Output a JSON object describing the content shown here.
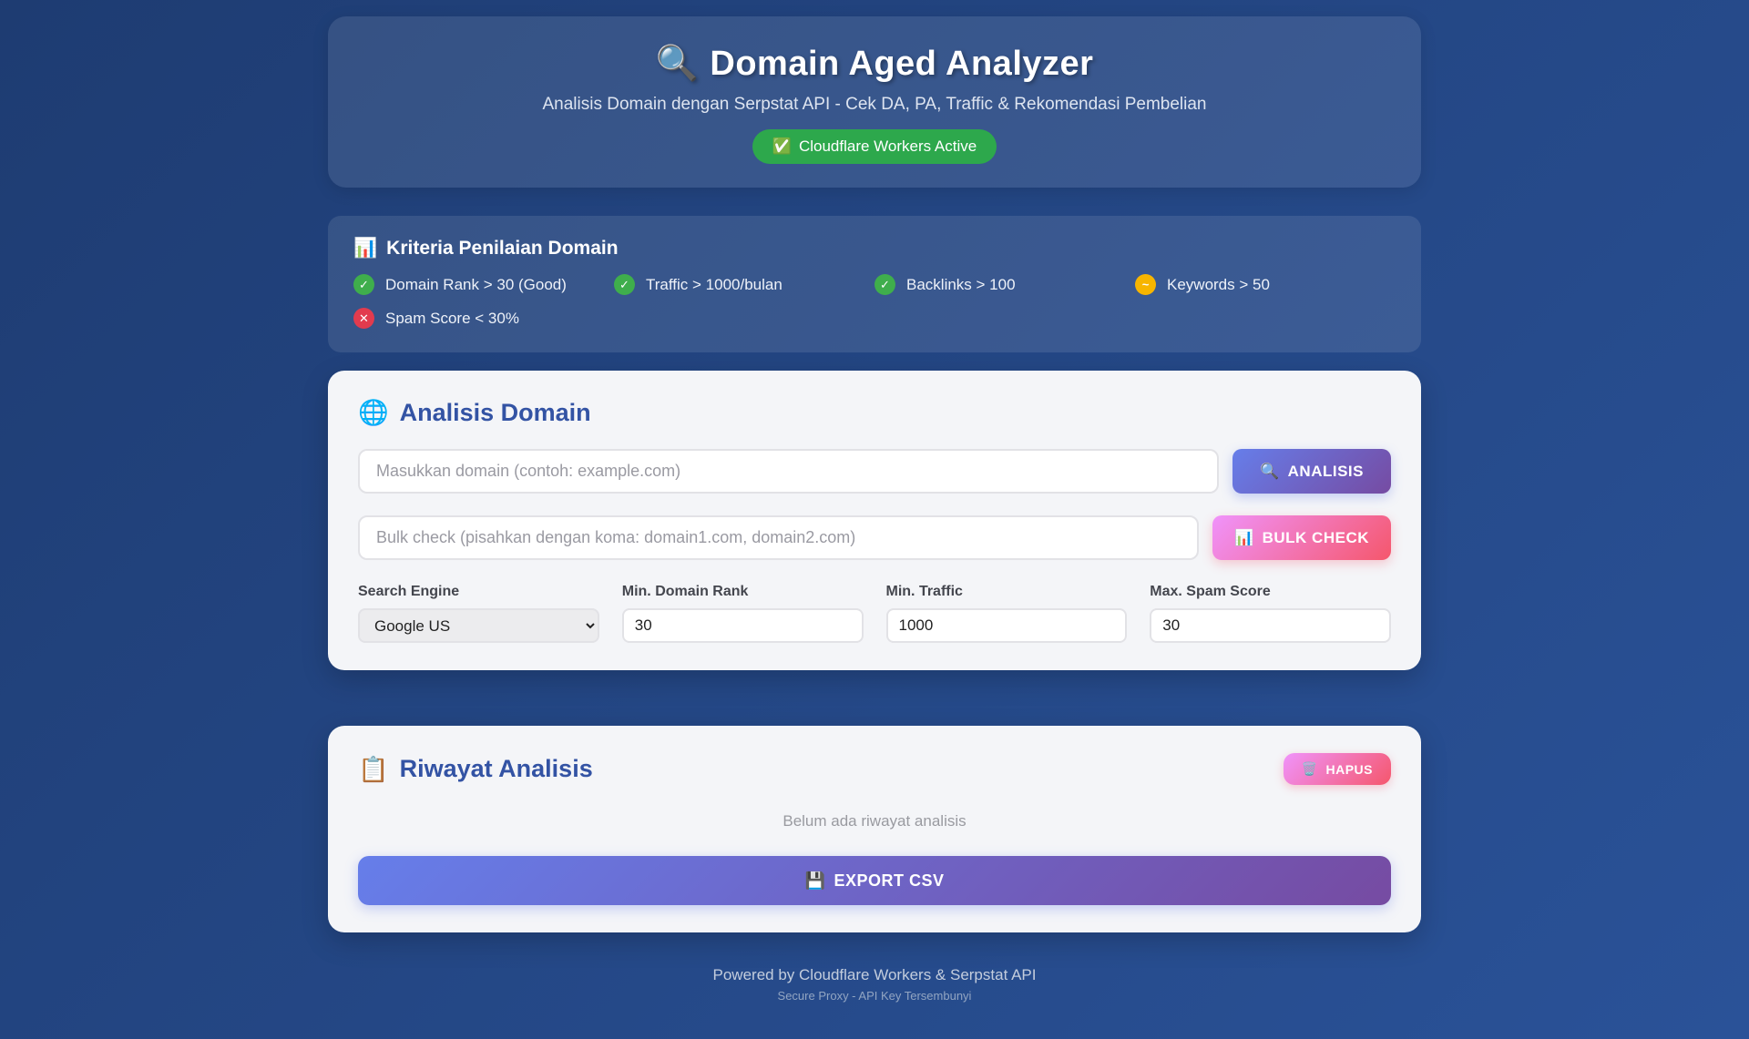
{
  "header": {
    "icon": "🔍",
    "title": "Domain Aged Analyzer",
    "subtitle": "Analisis Domain dengan Serpstat API - Cek DA, PA, Traffic & Rekomendasi Pembelian",
    "status_badge": {
      "icon": "✅",
      "label": "Cloudflare Workers Active"
    }
  },
  "criteria": {
    "icon": "📊",
    "title": "Kriteria Penilaian Domain",
    "items": [
      {
        "status": "pass",
        "glyph": "✓",
        "label": "Domain Rank > 30 (Good)"
      },
      {
        "status": "pass",
        "glyph": "✓",
        "label": "Traffic > 1000/bulan"
      },
      {
        "status": "pass",
        "glyph": "✓",
        "label": "Backlinks > 100"
      },
      {
        "status": "warn",
        "glyph": "~",
        "label": "Keywords > 50"
      },
      {
        "status": "fail",
        "glyph": "✕",
        "label": "Spam Score < 30%"
      }
    ]
  },
  "analyzer": {
    "icon": "🌐",
    "title": "Analisis Domain",
    "domain_input_placeholder": "Masukkan domain (contoh: example.com)",
    "analyze_button": {
      "icon": "🔍",
      "label": "ANALISIS"
    },
    "bulk_input_placeholder": "Bulk check (pisahkan dengan koma: domain1.com, domain2.com)",
    "bulk_button": {
      "icon": "📊",
      "label": "BULK CHECK"
    },
    "fields": {
      "search_engine": {
        "label": "Search Engine",
        "value": "Google US"
      },
      "min_domain_rank": {
        "label": "Min. Domain Rank",
        "value": "30"
      },
      "min_traffic": {
        "label": "Min. Traffic",
        "value": "1000"
      },
      "max_spam_score": {
        "label": "Max. Spam Score",
        "value": "30"
      }
    }
  },
  "history": {
    "icon": "📋",
    "title": "Riwayat Analisis",
    "clear_button": {
      "icon": "🗑️",
      "label": "HAPUS"
    },
    "empty_message": "Belum ada riwayat analisis",
    "export_button": {
      "icon": "💾",
      "label": "EXPORT CSV"
    }
  },
  "footer": {
    "line1": "Powered by Cloudflare Workers & Serpstat API",
    "line2": "Secure Proxy - API Key Tersembunyi"
  },
  "colors": {
    "page_bg_start": "#1e3c72",
    "page_bg_end": "#2a5298",
    "panel_bg": "rgba(255,255,255,0.10)",
    "card_bg": "#f4f5f8",
    "accent_blue": "#3353a4",
    "badge_green": "#2da84c",
    "pass_green": "#3fae4c",
    "warn_yellow": "#f7b500",
    "fail_red": "#e23b4e",
    "purple_gradient_start": "#667eea",
    "purple_gradient_end": "#764ba2",
    "pink_gradient_start": "#f093fb",
    "pink_gradient_end": "#f5576c"
  }
}
